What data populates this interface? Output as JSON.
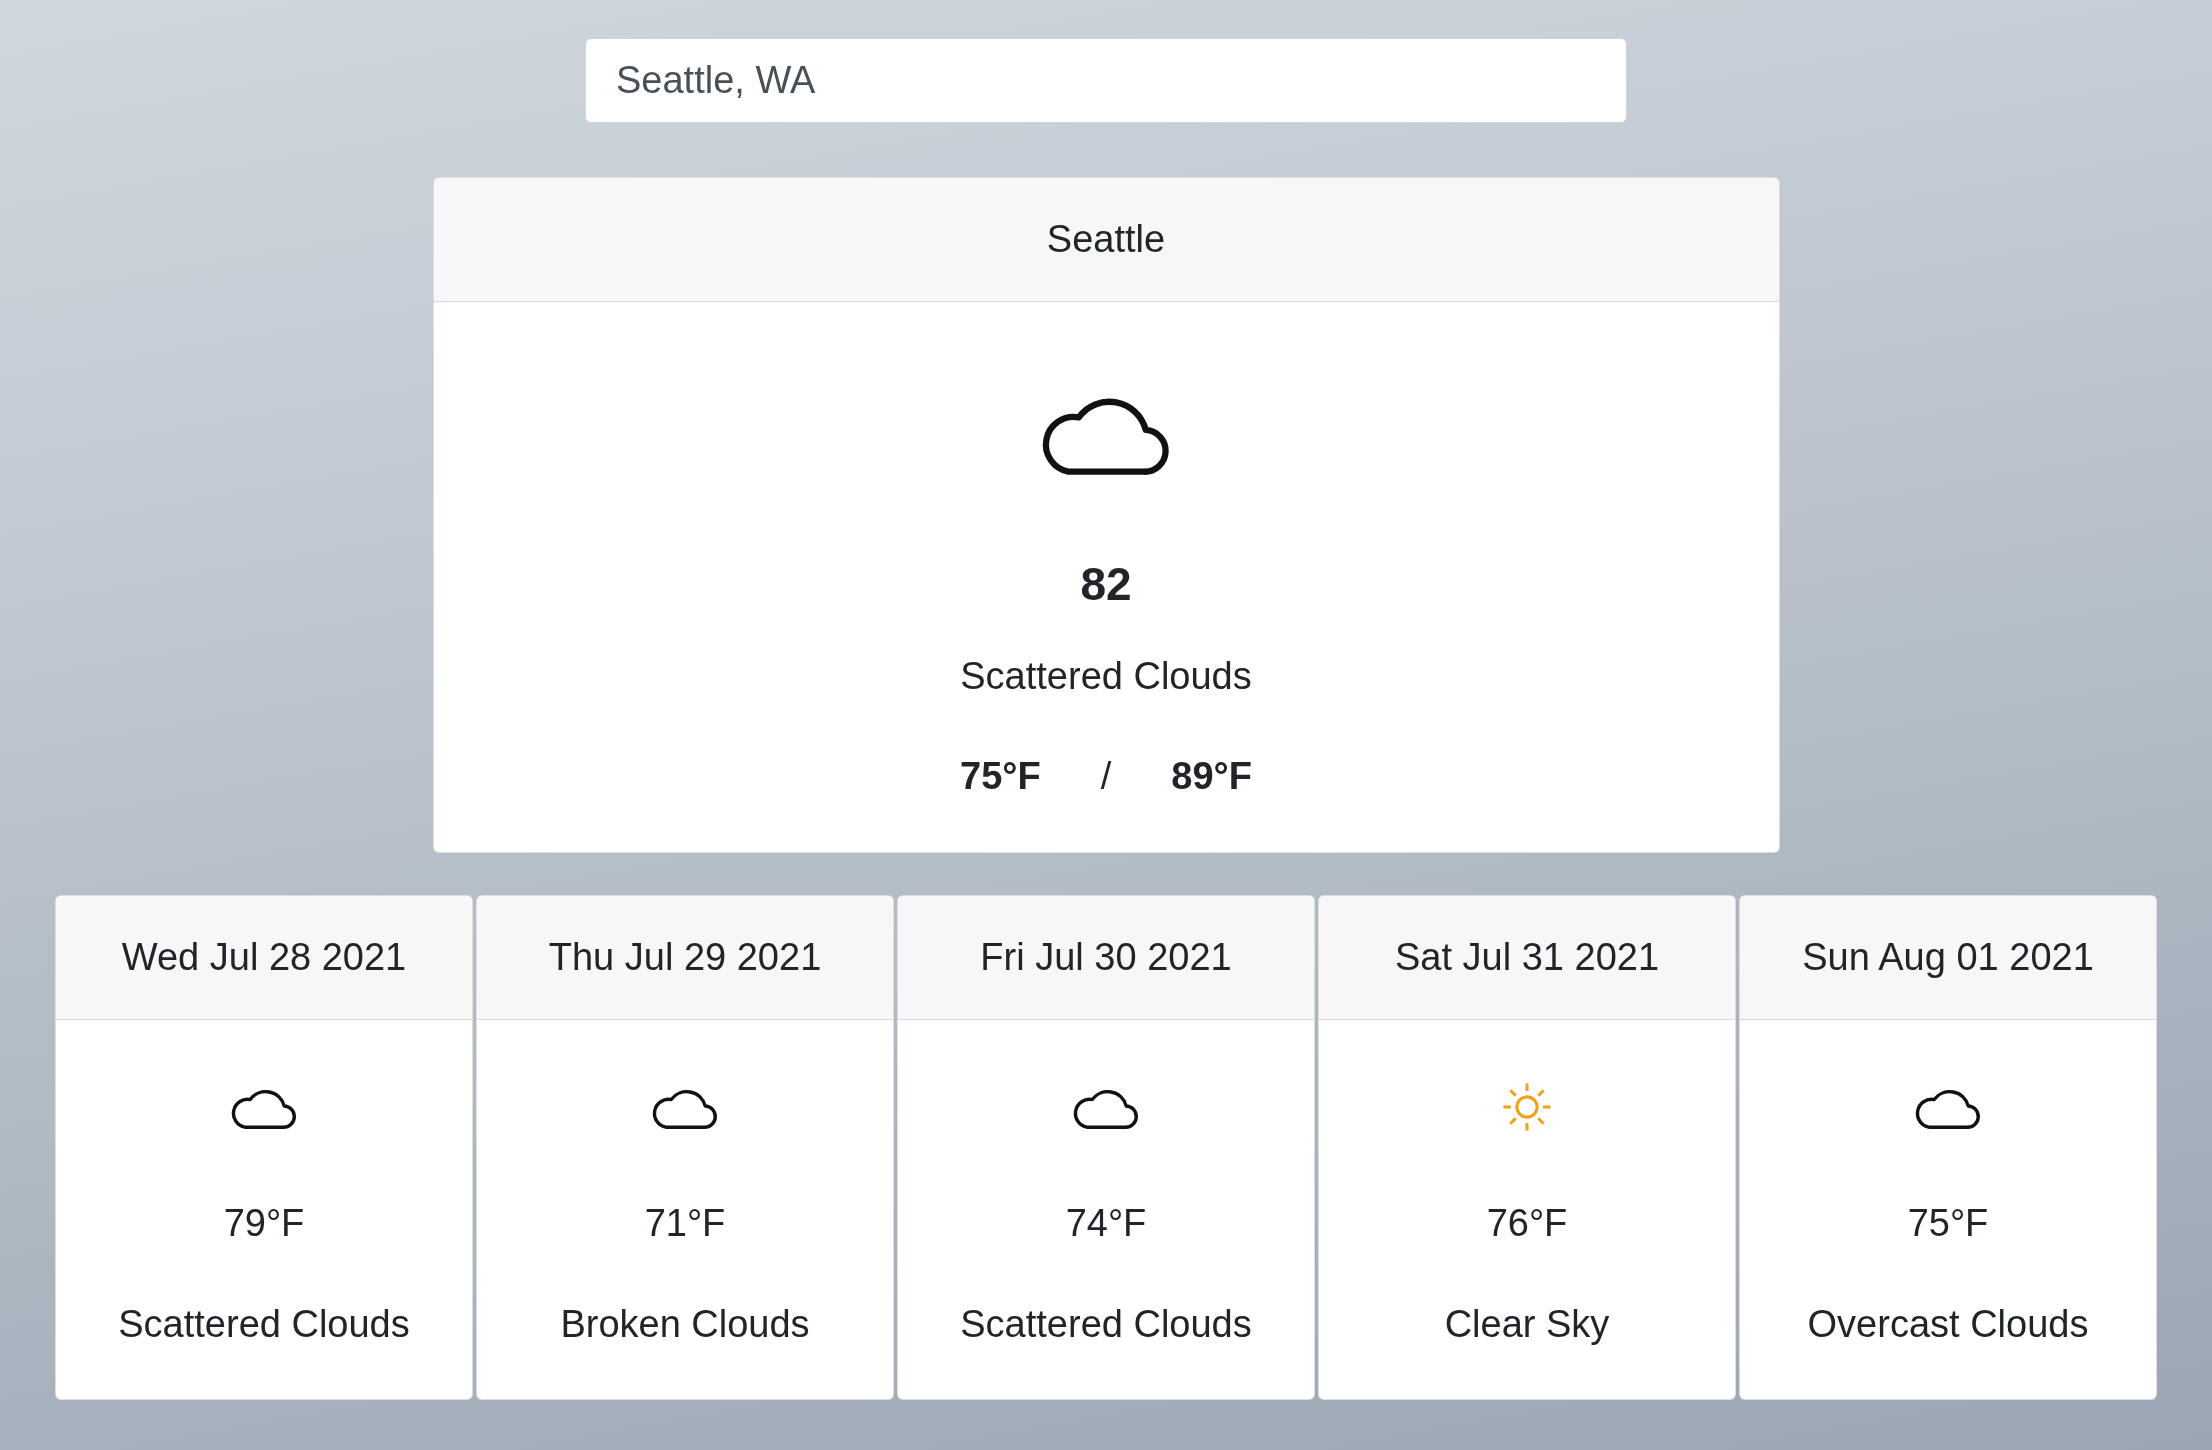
{
  "search": {
    "value": "Seattle, WA"
  },
  "current": {
    "city": "Seattle",
    "kind": "cloud",
    "temperature": "82",
    "description": "Scattered Clouds",
    "low": "75°F",
    "separator": "/",
    "high": "89°F"
  },
  "forecast": [
    {
      "date": "Wed Jul 28 2021",
      "kind": "cloud",
      "temperature": "79°F",
      "description": "Scattered Clouds"
    },
    {
      "date": "Thu Jul 29 2021",
      "kind": "cloud",
      "temperature": "71°F",
      "description": "Broken Clouds"
    },
    {
      "date": "Fri Jul 30 2021",
      "kind": "cloud",
      "temperature": "74°F",
      "description": "Scattered Clouds"
    },
    {
      "date": "Sat Jul 31 2021",
      "kind": "sun",
      "temperature": "76°F",
      "description": "Clear Sky"
    },
    {
      "date": "Sun Aug 01 2021",
      "kind": "cloud",
      "temperature": "75°F",
      "description": "Overcast Clouds"
    }
  ]
}
